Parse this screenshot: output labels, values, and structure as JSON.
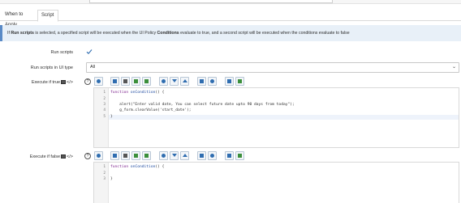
{
  "tabs": [
    {
      "label": "When to Apply"
    },
    {
      "label": "Script"
    }
  ],
  "info": {
    "prefix": "If ",
    "run_scripts_bold": "Run scripts",
    "middle": " is selected, a specified script will be executed when the UI Policy ",
    "conditions_bold": "Conditions",
    "suffix": " evaluate to true, and a second script will be executed when the conditions evaluate to false"
  },
  "fields": {
    "run_scripts_label": "Run scripts",
    "run_scripts_checked": true,
    "run_in_ui_type_label": "Run scripts in UI type",
    "run_in_ui_type_value": "All",
    "execute_true_label": "Execute if true",
    "execute_false_label": "Execute if false"
  },
  "icons": {
    "help": "?",
    "chevron": "⌄",
    "fold": "▾"
  },
  "editor_true": {
    "lines": [
      {
        "num": "1",
        "text": "function onCondition() {"
      },
      {
        "num": "2",
        "text": ""
      },
      {
        "num": "3",
        "text": "    alert(\"Enter valid date, You can select future date upto 90 days from today\");"
      },
      {
        "num": "4",
        "text": "    g_form.clearValue('start_date');"
      },
      {
        "num": "5",
        "text": "}"
      }
    ]
  },
  "editor_false": {
    "lines": [
      {
        "num": "1",
        "text": "function onCondition() {"
      },
      {
        "num": "2",
        "text": ""
      },
      {
        "num": "3",
        "text": "}"
      }
    ]
  },
  "colors": {
    "info_bg": "#e8f0f8",
    "info_border": "#5a8ac6",
    "keyword": "#7a1f8b",
    "function_name": "#1e4aa0",
    "string": "#a31515",
    "check": "#2f6db0"
  }
}
